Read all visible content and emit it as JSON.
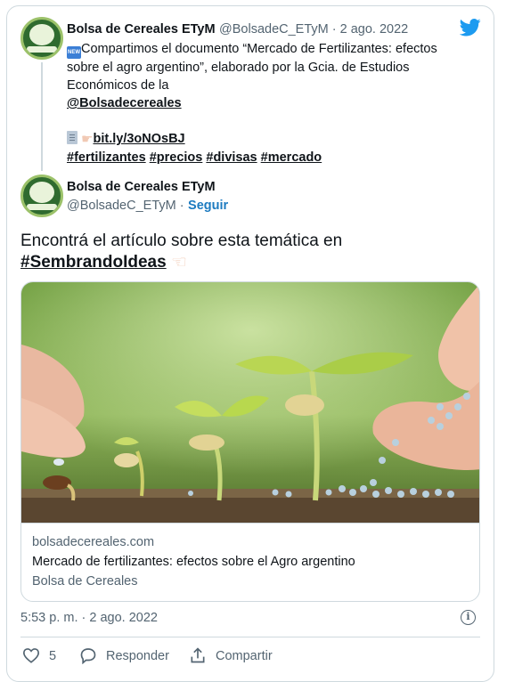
{
  "tweet1": {
    "author_name": "Bolsa de Cereales ETyM",
    "handle_date": "@BolsadeC_ETyM · 2 ago. 2022",
    "badge_text": "NEW",
    "text_line1": "Compartimos el documento “Mercado de Fertilizantes: efectos",
    "text_line2": "sobre el agro argentino”, elaborado por la Gcia. de Estudios",
    "text_line3": "Económicos de la",
    "mention": "@Bolsadecereales",
    "short_link": "bit.ly/3oNOsBJ",
    "hashtags": [
      "#fertilizantes",
      "#precios",
      "#divisas",
      "#mercado"
    ]
  },
  "tweet2": {
    "author_name": "Bolsa de Cereales ETyM",
    "handle": "@BolsadeC_ETyM ·",
    "follow_label": "Seguir",
    "text": "Encontrá el artículo sobre esta temática en",
    "hashtag": "#SembrandoIdeas",
    "card_domain": "bolsadecereales.com",
    "card_title": "Mercado de fertilizantes: efectos sobre el Agro argentino",
    "card_source": "Bolsa de Cereales",
    "timestamp": "5:53 p. m. · 2 ago. 2022",
    "info_glyph": "i",
    "likes": "5",
    "reply_label": "Responder",
    "share_label": "Compartir"
  },
  "colors": {
    "link_blue": "#1d7bc0",
    "twitter_blue": "#1d9bf0",
    "border": "#cfd9de",
    "muted": "#536471"
  },
  "icons": [
    "twitter-bird-icon",
    "new-badge-icon",
    "document-icon",
    "pointing-hand-icon",
    "info-icon",
    "heart-icon",
    "reply-icon",
    "share-icon"
  ]
}
